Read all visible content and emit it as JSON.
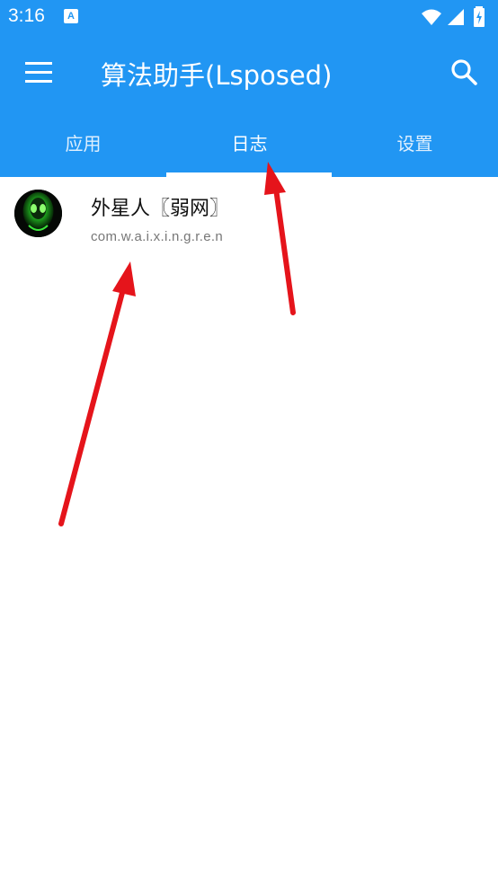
{
  "status_bar": {
    "time": "3:16",
    "notification_icon": "a-box-icon",
    "icons": [
      "wifi-icon",
      "signal-icon",
      "battery-charging-icon"
    ]
  },
  "toolbar": {
    "menu_icon": "hamburger-menu-icon",
    "title": "算法助手(Lsposed)",
    "search_icon": "search-icon"
  },
  "tabs": [
    {
      "label": "应用",
      "active": false
    },
    {
      "label": "日志",
      "active": true
    },
    {
      "label": "设置",
      "active": false
    }
  ],
  "list": {
    "items": [
      {
        "name": "外星人〖弱网〗",
        "package": "com.w.a.i.x.i.n.g.r.e.n",
        "icon": "alien-avatar-icon"
      }
    ]
  },
  "colors": {
    "primary": "#2196F3",
    "on_primary": "#FFFFFF",
    "annotation_arrow": "#E5141B",
    "avatar_glow": "#3BE83B"
  }
}
